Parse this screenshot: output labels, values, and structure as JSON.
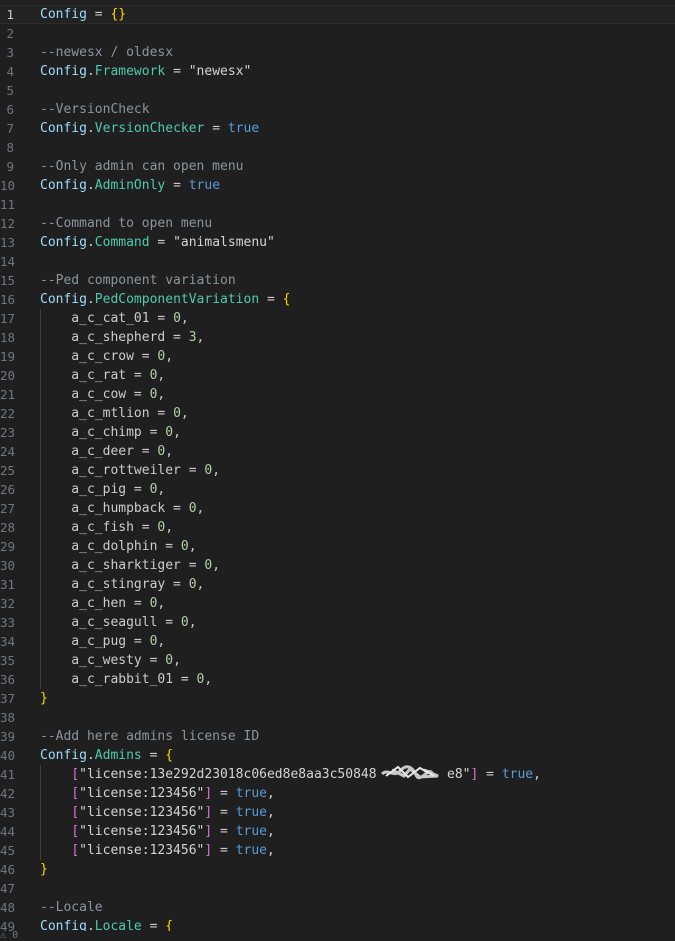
{
  "editor": {
    "lines": [
      {
        "n": "1",
        "tokens": [
          [
            "kw",
            "Config"
          ],
          [
            "op",
            " = "
          ],
          [
            "brace",
            "{}"
          ]
        ]
      },
      {
        "n": "2",
        "tokens": []
      },
      {
        "n": "3",
        "tokens": [
          [
            "cm",
            "--newesx / oldesx"
          ]
        ]
      },
      {
        "n": "4",
        "tokens": [
          [
            "kw",
            "Config"
          ],
          [
            "op",
            "."
          ],
          [
            "prop",
            "Framework"
          ],
          [
            "op",
            " = "
          ],
          [
            "str2",
            "\"newesx\""
          ]
        ]
      },
      {
        "n": "5",
        "tokens": []
      },
      {
        "n": "6",
        "tokens": [
          [
            "cm",
            "--VersionCheck"
          ]
        ]
      },
      {
        "n": "7",
        "tokens": [
          [
            "kw",
            "Config"
          ],
          [
            "op",
            "."
          ],
          [
            "prop",
            "VersionChecker"
          ],
          [
            "op",
            " = "
          ],
          [
            "bool",
            "true"
          ]
        ]
      },
      {
        "n": "8",
        "tokens": []
      },
      {
        "n": "9",
        "tokens": [
          [
            "cm",
            "--Only admin can open menu"
          ]
        ]
      },
      {
        "n": "10",
        "tokens": [
          [
            "kw",
            "Config"
          ],
          [
            "op",
            "."
          ],
          [
            "prop",
            "AdminOnly"
          ],
          [
            "op",
            " = "
          ],
          [
            "bool",
            "true"
          ]
        ]
      },
      {
        "n": "11",
        "tokens": []
      },
      {
        "n": "12",
        "tokens": [
          [
            "cm",
            "--Command to open menu"
          ]
        ]
      },
      {
        "n": "13",
        "tokens": [
          [
            "kw",
            "Config"
          ],
          [
            "op",
            "."
          ],
          [
            "prop",
            "Command"
          ],
          [
            "op",
            " = "
          ],
          [
            "str2",
            "\"animalsmenu\""
          ]
        ]
      },
      {
        "n": "14",
        "tokens": []
      },
      {
        "n": "15",
        "tokens": [
          [
            "cm",
            "--Ped component variation"
          ]
        ]
      },
      {
        "n": "16",
        "tokens": [
          [
            "kw",
            "Config"
          ],
          [
            "op",
            "."
          ],
          [
            "prop",
            "PedComponentVariation"
          ],
          [
            "op",
            " = "
          ],
          [
            "brace",
            "{"
          ]
        ]
      },
      {
        "n": "17",
        "tokens": [
          [
            "id",
            "    a_c_cat_01"
          ],
          [
            "op",
            " = "
          ],
          [
            "num",
            "0"
          ],
          [
            "op",
            ","
          ]
        ]
      },
      {
        "n": "18",
        "tokens": [
          [
            "id",
            "    a_c_shepherd"
          ],
          [
            "op",
            " = "
          ],
          [
            "num",
            "3"
          ],
          [
            "op",
            ","
          ]
        ]
      },
      {
        "n": "19",
        "tokens": [
          [
            "id",
            "    a_c_crow"
          ],
          [
            "op",
            " = "
          ],
          [
            "num",
            "0"
          ],
          [
            "op",
            ","
          ]
        ]
      },
      {
        "n": "20",
        "tokens": [
          [
            "id",
            "    a_c_rat"
          ],
          [
            "op",
            " = "
          ],
          [
            "num",
            "0"
          ],
          [
            "op",
            ","
          ]
        ]
      },
      {
        "n": "21",
        "tokens": [
          [
            "id",
            "    a_c_cow"
          ],
          [
            "op",
            " = "
          ],
          [
            "num",
            "0"
          ],
          [
            "op",
            ","
          ]
        ]
      },
      {
        "n": "22",
        "tokens": [
          [
            "id",
            "    a_c_mtlion"
          ],
          [
            "op",
            " = "
          ],
          [
            "num",
            "0"
          ],
          [
            "op",
            ","
          ]
        ]
      },
      {
        "n": "23",
        "tokens": [
          [
            "id",
            "    a_c_chimp"
          ],
          [
            "op",
            " = "
          ],
          [
            "num",
            "0"
          ],
          [
            "op",
            ","
          ]
        ]
      },
      {
        "n": "24",
        "tokens": [
          [
            "id",
            "    a_c_deer"
          ],
          [
            "op",
            " = "
          ],
          [
            "num",
            "0"
          ],
          [
            "op",
            ","
          ]
        ]
      },
      {
        "n": "25",
        "tokens": [
          [
            "id",
            "    a_c_rottweiler"
          ],
          [
            "op",
            " = "
          ],
          [
            "num",
            "0"
          ],
          [
            "op",
            ","
          ]
        ]
      },
      {
        "n": "26",
        "tokens": [
          [
            "id",
            "    a_c_pig"
          ],
          [
            "op",
            " = "
          ],
          [
            "num",
            "0"
          ],
          [
            "op",
            ","
          ]
        ]
      },
      {
        "n": "27",
        "tokens": [
          [
            "id",
            "    a_c_humpback"
          ],
          [
            "op",
            " = "
          ],
          [
            "num",
            "0"
          ],
          [
            "op",
            ","
          ]
        ]
      },
      {
        "n": "28",
        "tokens": [
          [
            "id",
            "    a_c_fish"
          ],
          [
            "op",
            " = "
          ],
          [
            "num",
            "0"
          ],
          [
            "op",
            ","
          ]
        ]
      },
      {
        "n": "29",
        "tokens": [
          [
            "id",
            "    a_c_dolphin"
          ],
          [
            "op",
            " = "
          ],
          [
            "num",
            "0"
          ],
          [
            "op",
            ","
          ]
        ]
      },
      {
        "n": "30",
        "tokens": [
          [
            "id",
            "    a_c_sharktiger"
          ],
          [
            "op",
            " = "
          ],
          [
            "num",
            "0"
          ],
          [
            "op",
            ","
          ]
        ]
      },
      {
        "n": "31",
        "tokens": [
          [
            "id",
            "    a_c_stingray"
          ],
          [
            "op",
            " = "
          ],
          [
            "num",
            "0"
          ],
          [
            "op",
            ","
          ]
        ]
      },
      {
        "n": "32",
        "tokens": [
          [
            "id",
            "    a_c_hen"
          ],
          [
            "op",
            " = "
          ],
          [
            "num",
            "0"
          ],
          [
            "op",
            ","
          ]
        ]
      },
      {
        "n": "33",
        "tokens": [
          [
            "id",
            "    a_c_seagull"
          ],
          [
            "op",
            " = "
          ],
          [
            "num",
            "0"
          ],
          [
            "op",
            ","
          ]
        ]
      },
      {
        "n": "34",
        "tokens": [
          [
            "id",
            "    a_c_pug"
          ],
          [
            "op",
            " = "
          ],
          [
            "num",
            "0"
          ],
          [
            "op",
            ","
          ]
        ]
      },
      {
        "n": "35",
        "tokens": [
          [
            "id",
            "    a_c_westy"
          ],
          [
            "op",
            " = "
          ],
          [
            "num",
            "0"
          ],
          [
            "op",
            ","
          ]
        ]
      },
      {
        "n": "36",
        "tokens": [
          [
            "id",
            "    a_c_rabbit_01"
          ],
          [
            "op",
            " = "
          ],
          [
            "num",
            "0"
          ],
          [
            "op",
            ","
          ]
        ]
      },
      {
        "n": "37",
        "tokens": [
          [
            "brace",
            "}"
          ]
        ]
      },
      {
        "n": "38",
        "tokens": []
      },
      {
        "n": "39",
        "tokens": [
          [
            "cm",
            "--Add here admins license ID"
          ]
        ]
      },
      {
        "n": "40",
        "tokens": [
          [
            "kw",
            "Config"
          ],
          [
            "op",
            "."
          ],
          [
            "prop",
            "Admins"
          ],
          [
            "op",
            " = "
          ],
          [
            "brace",
            "{"
          ]
        ]
      },
      {
        "n": "41",
        "tokens": [
          [
            "op",
            "    "
          ],
          [
            "brack",
            "["
          ],
          [
            "str2",
            "\"license:13e292d23018c06ed8e8aa3c50848"
          ],
          [
            "op",
            "         "
          ],
          [
            "str2",
            "e8\""
          ],
          [
            "brack",
            "]"
          ],
          [
            "op",
            " = "
          ],
          [
            "bool",
            "true"
          ],
          [
            "op",
            ","
          ]
        ]
      },
      {
        "n": "42",
        "tokens": [
          [
            "op",
            "    "
          ],
          [
            "brack",
            "["
          ],
          [
            "str2",
            "\"license:123456\""
          ],
          [
            "brack",
            "]"
          ],
          [
            "op",
            " = "
          ],
          [
            "bool",
            "true"
          ],
          [
            "op",
            ","
          ]
        ]
      },
      {
        "n": "43",
        "tokens": [
          [
            "op",
            "    "
          ],
          [
            "brack",
            "["
          ],
          [
            "str2",
            "\"license:123456\""
          ],
          [
            "brack",
            "]"
          ],
          [
            "op",
            " = "
          ],
          [
            "bool",
            "true"
          ],
          [
            "op",
            ","
          ]
        ]
      },
      {
        "n": "44",
        "tokens": [
          [
            "op",
            "    "
          ],
          [
            "brack",
            "["
          ],
          [
            "str2",
            "\"license:123456\""
          ],
          [
            "brack",
            "]"
          ],
          [
            "op",
            " = "
          ],
          [
            "bool",
            "true"
          ],
          [
            "op",
            ","
          ]
        ]
      },
      {
        "n": "45",
        "tokens": [
          [
            "op",
            "    "
          ],
          [
            "brack",
            "["
          ],
          [
            "str2",
            "\"license:123456\""
          ],
          [
            "brack",
            "]"
          ],
          [
            "op",
            " = "
          ],
          [
            "bool",
            "true"
          ],
          [
            "op",
            ","
          ]
        ]
      },
      {
        "n": "46",
        "tokens": [
          [
            "brace",
            "}"
          ]
        ]
      },
      {
        "n": "47",
        "tokens": []
      },
      {
        "n": "48",
        "tokens": [
          [
            "cm",
            "--Locale"
          ]
        ]
      },
      {
        "n": "49",
        "tokens": [
          [
            "kw",
            "Config"
          ],
          [
            "op",
            "."
          ],
          [
            "prop",
            "Locale"
          ],
          [
            "op",
            " = "
          ],
          [
            "brace",
            "{"
          ]
        ]
      }
    ],
    "current_line": "1"
  },
  "status": {
    "warning_count": "0"
  },
  "colors": {
    "background": "#1f1f1f",
    "keyword": "#9cdcfe",
    "property": "#4ec9b0",
    "comment": "#8b949e",
    "boolean": "#569cd6",
    "number": "#b5cea8",
    "brace": "#ffd700",
    "bracket": "#da70d6"
  }
}
